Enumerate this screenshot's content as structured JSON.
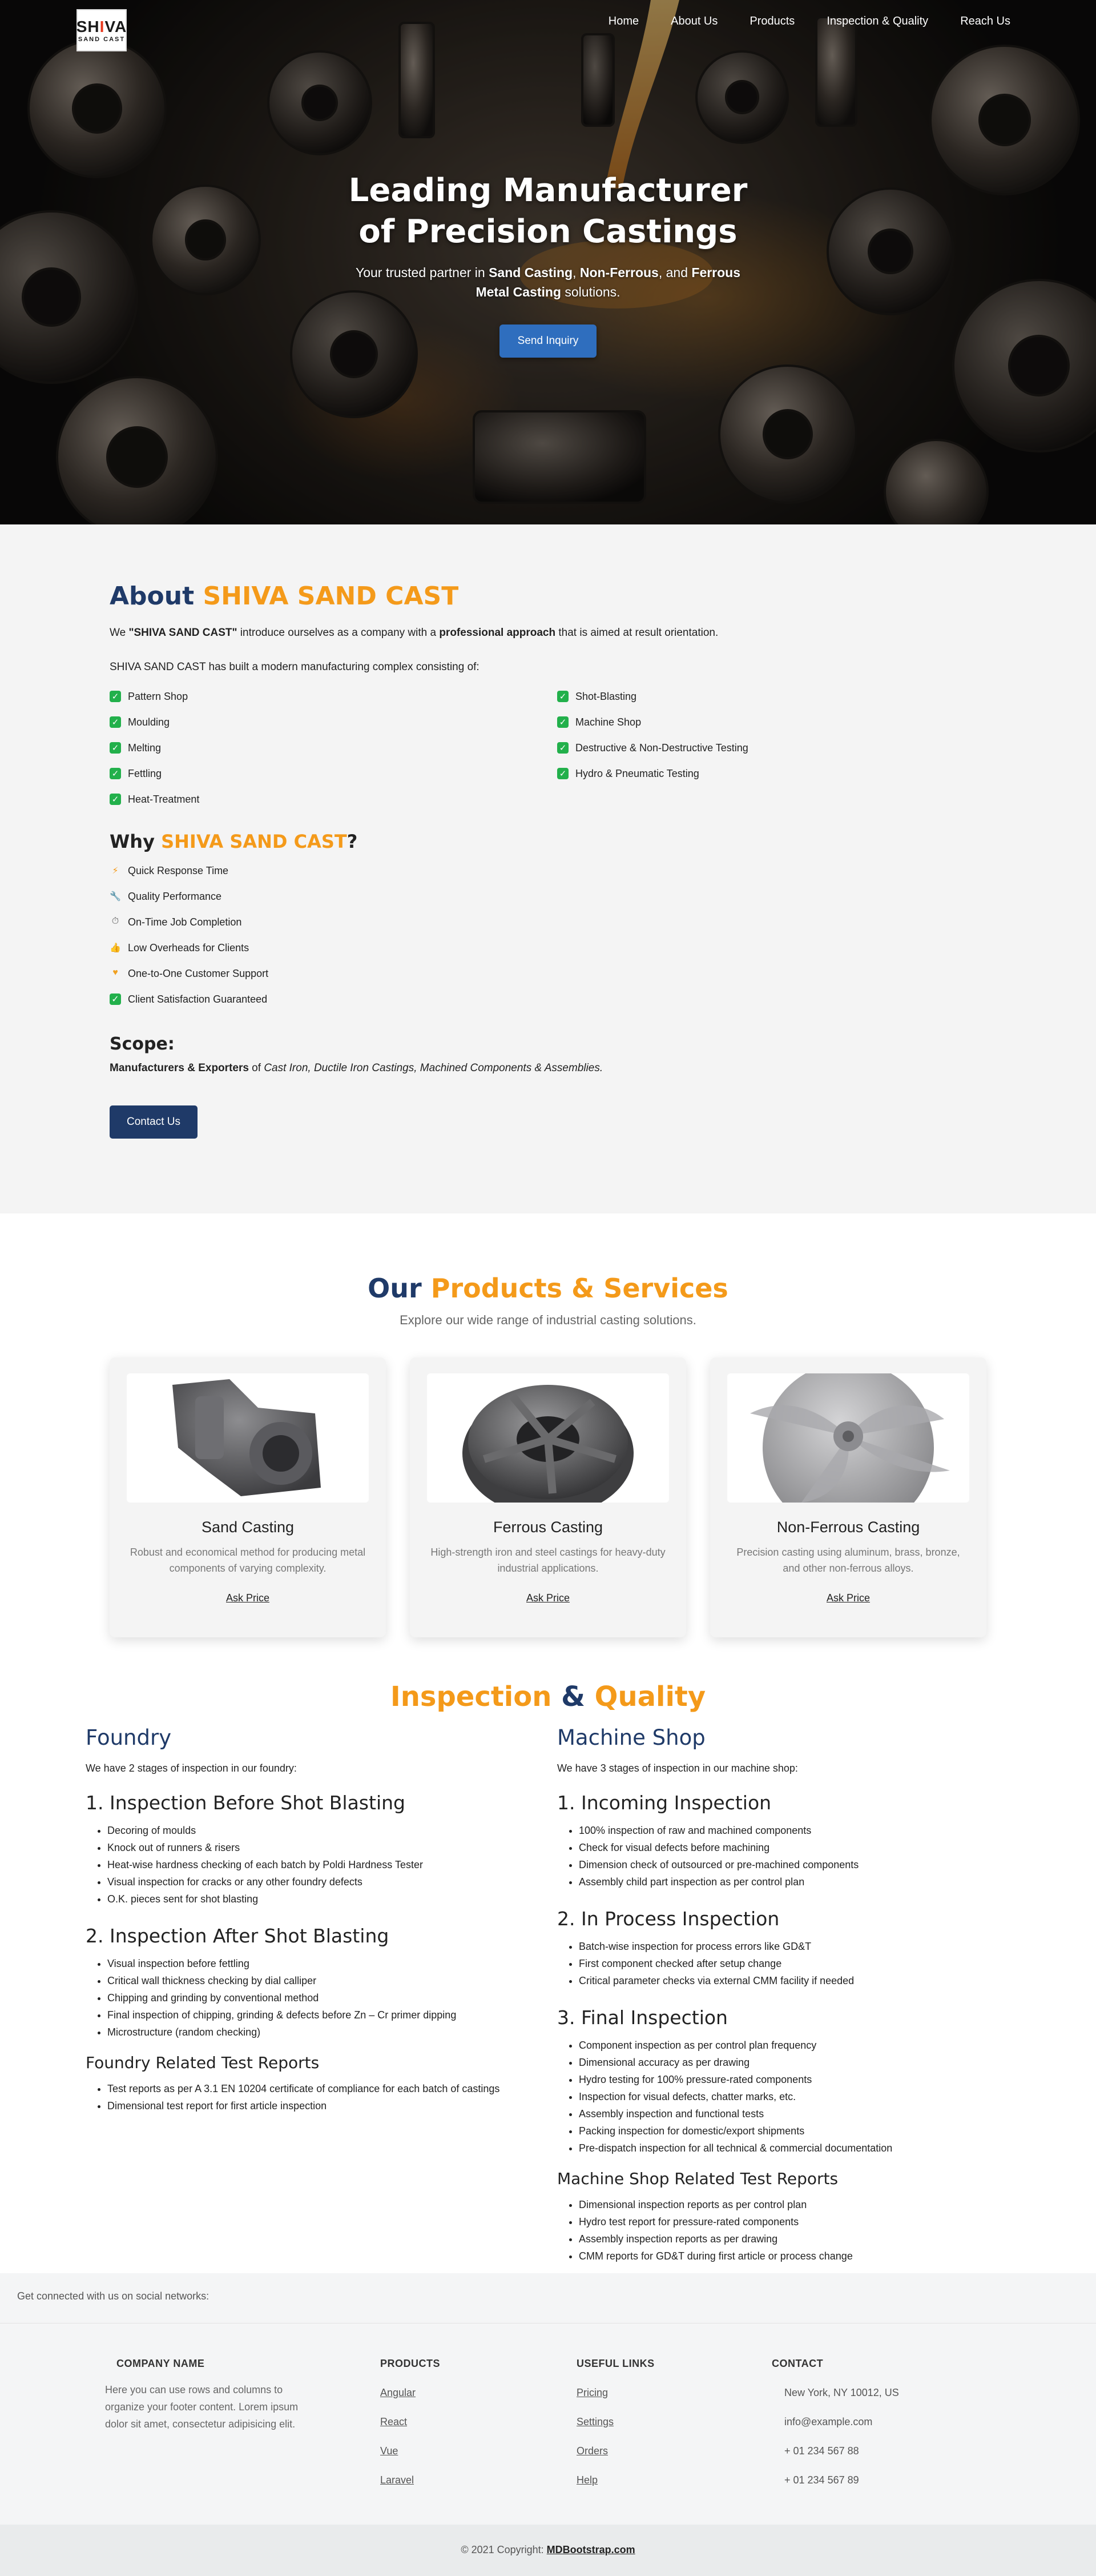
{
  "header": {
    "logo_top": "SH",
    "logo_accent": "I",
    "logo_tail": "VA",
    "logo_bottom": "SAND CAST",
    "nav": [
      {
        "label": "Home"
      },
      {
        "label": "About Us"
      },
      {
        "label": "Products"
      },
      {
        "label": "Inspection & Quality"
      },
      {
        "label": "Reach Us"
      }
    ]
  },
  "hero": {
    "title": "Leading Manufacturer of Precision Castings",
    "sub_part1": "Your trusted partner in ",
    "sub_b1": "Sand Casting",
    "sub_sep1": ", ",
    "sub_b2": "Non-Ferrous",
    "sub_sep2": ", and ",
    "sub_b3": "Ferrous Metal Casting",
    "sub_end": " solutions.",
    "button": "Send Inquiry"
  },
  "about": {
    "title_plain": "About ",
    "title_brand": "SHIVA SAND CAST",
    "intro_we": "We ",
    "intro_brand": "\"SHIVA SAND CAST\"",
    "intro_mid": " introduce ourselves as a company with a ",
    "intro_bold": "professional approach",
    "intro_end": " that is aimed at result orientation.",
    "complex_text": "SHIVA SAND CAST has built a modern manufacturing complex consisting of:",
    "facilities_left": [
      "Pattern Shop",
      "Moulding",
      "Melting",
      "Fettling",
      "Heat-Treatment"
    ],
    "facilities_right": [
      "Shot-Blasting",
      "Machine Shop",
      "Destructive & Non-Destructive Testing",
      "Hydro & Pneumatic Testing"
    ],
    "why_plain": "Why ",
    "why_brand": "SHIVA SAND CAST",
    "why_q": "?",
    "why_items": [
      {
        "icon": "lightning-icon",
        "label": "Quick Response Time"
      },
      {
        "icon": "wrench-icon",
        "label": "Quality Performance"
      },
      {
        "icon": "stopwatch-icon",
        "label": "On-Time Job Completion"
      },
      {
        "icon": "thumbs-up-icon",
        "label": "Low Overheads for Clients"
      },
      {
        "icon": "heart-icon",
        "label": "One-to-One Customer Support"
      },
      {
        "icon": "check-icon",
        "label": "Client Satisfaction Guaranteed"
      }
    ],
    "scope_title": "Scope:",
    "scope_bold": "Manufacturers & Exporters",
    "scope_of": " of ",
    "scope_italic": "Cast Iron, Ductile Iron Castings, Machined Components & Assemblies.",
    "contact_button": "Contact Us"
  },
  "products": {
    "title_plain": "Our ",
    "title_accent": "Products & Services",
    "subtitle": "Explore our wide range of industrial casting solutions.",
    "cards": [
      {
        "title": "Sand Casting",
        "desc": "Robust and economical method for producing metal components of varying complexity.",
        "cta": "Ask Price"
      },
      {
        "title": "Ferrous Casting",
        "desc": "High-strength iron and steel castings for heavy-duty industrial applications.",
        "cta": "Ask Price"
      },
      {
        "title": "Non-Ferrous Casting",
        "desc": "Precision casting using aluminum, brass, bronze, and other non-ferrous alloys.",
        "cta": "Ask Price"
      }
    ]
  },
  "inspection": {
    "title_a": "Inspection",
    "title_amp": " & ",
    "title_b": "Quality",
    "foundry": {
      "title": "Foundry",
      "lead": "We have 2 stages of inspection in our foundry:",
      "stage1_title": "1. Inspection Before Shot Blasting",
      "stage1_items": [
        "Decoring of moulds",
        "Knock out of runners & risers",
        "Heat-wise hardness checking of each batch by Poldi Hardness Tester",
        "Visual inspection for cracks or any other foundry defects",
        "O.K. pieces sent for shot blasting"
      ],
      "stage2_title": "2. Inspection After Shot Blasting",
      "stage2_items": [
        "Visual inspection before fettling",
        "Critical wall thickness checking by dial calliper",
        "Chipping and grinding by conventional method",
        "Final inspection of chipping, grinding & defects before Zn – Cr primer dipping",
        "Microstructure (random checking)"
      ],
      "reports_title": "Foundry Related Test Reports",
      "reports_items": [
        "Test reports as per A 3.1 EN 10204 certificate of compliance for each batch of castings",
        "Dimensional test report for first article inspection"
      ]
    },
    "machine": {
      "title": "Machine Shop",
      "lead": "We have 3 stages of inspection in our machine shop:",
      "stage1_title": "1. Incoming Inspection",
      "stage1_items": [
        "100% inspection of raw and machined components",
        "Check for visual defects before machining",
        "Dimension check of outsourced or pre-machined components",
        "Assembly child part inspection as per control plan"
      ],
      "stage2_title": "2. In Process Inspection",
      "stage2_items": [
        "Batch-wise inspection for process errors like GD&T",
        "First component checked after setup change",
        "Critical parameter checks via external CMM facility if needed"
      ],
      "stage3_title": "3. Final Inspection",
      "stage3_items": [
        "Component inspection as per control plan frequency",
        "Dimensional accuracy as per drawing",
        "Hydro testing for 100% pressure-rated components",
        "Inspection for visual defects, chatter marks, etc.",
        "Assembly inspection and functional tests",
        "Packing inspection for domestic/export shipments",
        "Pre-dispatch inspection for all technical & commercial documentation"
      ],
      "reports_title": "Machine Shop Related Test Reports",
      "reports_items": [
        "Dimensional inspection reports as per control plan",
        "Hydro test report for pressure-rated components",
        "Assembly inspection reports as per drawing",
        "CMM reports for GD&T during first article or process change"
      ]
    }
  },
  "footer": {
    "social_text": "Get connected with us on social networks:",
    "company_title": "COMPANY NAME",
    "company_desc": "Here you can use rows and columns to organize your footer content. Lorem ipsum dolor sit amet, consectetur adipisicing elit.",
    "products_title": "PRODUCTS",
    "products_links": [
      "Angular",
      "React",
      "Vue",
      "Laravel"
    ],
    "useful_title": "USEFUL LINKS",
    "useful_links": [
      "Pricing",
      "Settings",
      "Orders",
      "Help"
    ],
    "contact_title": "CONTACT",
    "contact_items": [
      "New York, NY 10012, US",
      "info@example.com",
      "+ 01 234 567 88",
      "+ 01 234 567 89"
    ],
    "copyright_text": "© 2021 Copyright: ",
    "copyright_link": "MDBootstrap.com"
  },
  "colors": {
    "navy": "#1f3a68",
    "orange": "#f49a1a",
    "hero_button": "#2f6ebe",
    "check_green": "#22b04b"
  }
}
